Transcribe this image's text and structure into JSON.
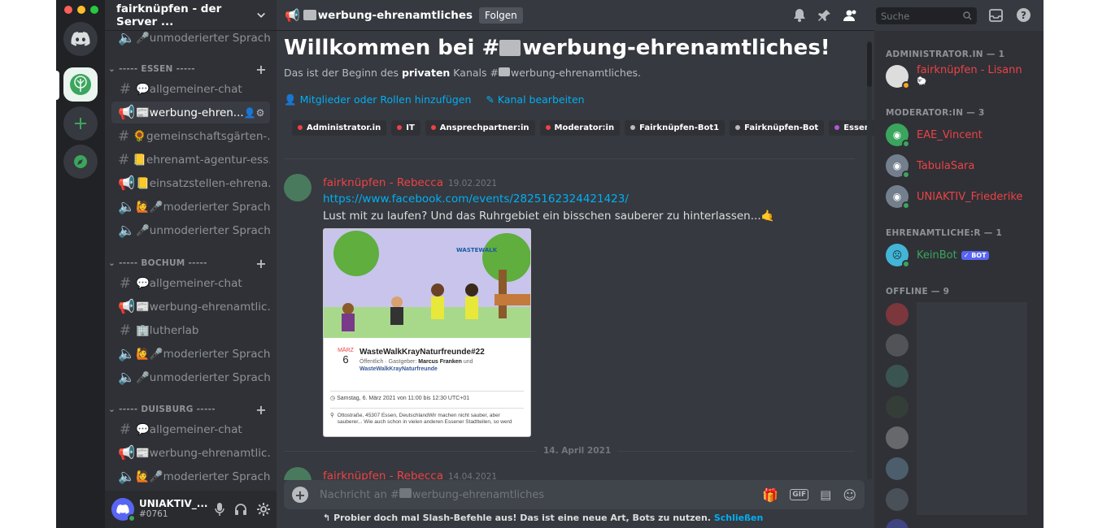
{
  "server": {
    "name": "fairknüpfen - der Server ..."
  },
  "colors": {
    "accent": "#5865f2",
    "online": "#3ba55d",
    "admin": "#ed4245",
    "link": "#00aff4"
  },
  "channels": {
    "top_item": "🎤unmoderierter Sprach...",
    "categories": [
      {
        "name": "----- ESSEN -----",
        "items": [
          "💬allgemeiner-chat",
          "📰werbung-ehren...",
          "🌻gemeinschaftsgärten-...",
          "📒ehrenamt-agentur-ess...",
          "📒einsatzstellen-ehrena...",
          "🙋🎤moderierter Sprach...",
          "🎤unmoderierter Sprach..."
        ]
      },
      {
        "name": "----- BOCHUM -----",
        "items": [
          "💬allgemeiner-chat",
          "📰werbung-ehrenamtlic...",
          "🏢lutherlab",
          "🙋🎤moderierter Sprach...",
          "🎤unmoderierter Sprach..."
        ]
      },
      {
        "name": "----- DUISBURG -----",
        "items": [
          "💬allgemeiner-chat",
          "📰werbung-ehrenamtlic...",
          "🙋🎤moderierter Sprach..."
        ]
      }
    ]
  },
  "user_panel": {
    "name": "UNIAKTIV_...",
    "tag": "#0761"
  },
  "topbar": {
    "channel": "werbung-ehrenamtliches",
    "follow": "Folgen",
    "search_placeholder": "Suche"
  },
  "welcome": {
    "title_prefix": "Willkommen bei #",
    "title_channel": "werbung-ehrenamtliches!",
    "desc_before": "Das ist der Beginn des ",
    "desc_bold": "privaten",
    "desc_after": " Kanals #",
    "desc_channel": "werbung-ehrenamtliches.",
    "add_members": "Mitglieder oder Rollen hinzufügen",
    "edit_channel": "Kanal bearbeiten",
    "roles": [
      {
        "name": "Administrator.in",
        "color": "#ed4245"
      },
      {
        "name": "IT",
        "color": "#ed4245"
      },
      {
        "name": "Ansprechpartner:in",
        "color": "#ed4245"
      },
      {
        "name": "Moderator:in",
        "color": "#ed4245"
      },
      {
        "name": "Fairknüpfen-Bot1",
        "color": "#b9bbbe"
      },
      {
        "name": "Fairknüpfen-Bot",
        "color": "#b9bbbe"
      },
      {
        "name": "Essen",
        "color": "#b455d9"
      }
    ]
  },
  "messages": [
    {
      "author": "fairknüpfen - Rebecca",
      "time": "19.02.2021",
      "link": "https://www.facebook.com/events/2825162324421423/",
      "text": "Lust mit zu laufen? Und das Ruhrgebiet ein bisschen sauberer zu hinterlassen...🤙",
      "embed": {
        "brand": "WASTEWALK",
        "month": "MÄRZ",
        "day": "6",
        "title": "WasteWalkKrayNaturfreunde#22",
        "meta_prefix": "Öffentlich · Gastgeber: ",
        "host": "Marcus Franken",
        "meta_and": " und",
        "host2": "WasteWalkKrayNaturfreunde",
        "datetime": "Samstag, 6. März 2021 von 11:00 bis 12:30 UTC+01",
        "address": "Ottostraße, 45307 Essen, DeutschlandWir machen nicht sauber, aber sauberer... Wie auch schon in vielen anderen Essener Stadtteilen, so werd"
      }
    },
    {
      "author": "fairknüpfen - Rebecca",
      "time": "14.04.2021"
    }
  ],
  "divider": "14. April 2021",
  "composer": {
    "placeholder": "Nachricht an #",
    "placeholder_channel": "werbung-ehrenamtliches",
    "gif": "GIF"
  },
  "hint": {
    "text": "Probier doch mal Slash-Befehle aus! Das ist eine neue Art, Bots zu nutzen.",
    "link": "Schließen"
  },
  "members": {
    "groups": [
      {
        "title": "ADMINISTRATOR.IN — 1",
        "items": [
          {
            "name": "fairknüpfen - Lisann",
            "color": "#ed4245"
          }
        ]
      },
      {
        "title": "MODERATOR:IN — 3",
        "items": [
          {
            "name": "EAE_Vincent",
            "color": "#ed4245"
          },
          {
            "name": "TabulaSara",
            "color": "#ed4245"
          },
          {
            "name": "UNIAKTIV_Friederike",
            "color": "#ed4245"
          }
        ]
      },
      {
        "title": "EHRENAMTLICHE:R — 1",
        "items": [
          {
            "name": "KeinBot",
            "color": "#3ba55d",
            "badge": "✓ BOT"
          }
        ]
      },
      {
        "title": "OFFLINE — 9",
        "items": []
      }
    ]
  }
}
